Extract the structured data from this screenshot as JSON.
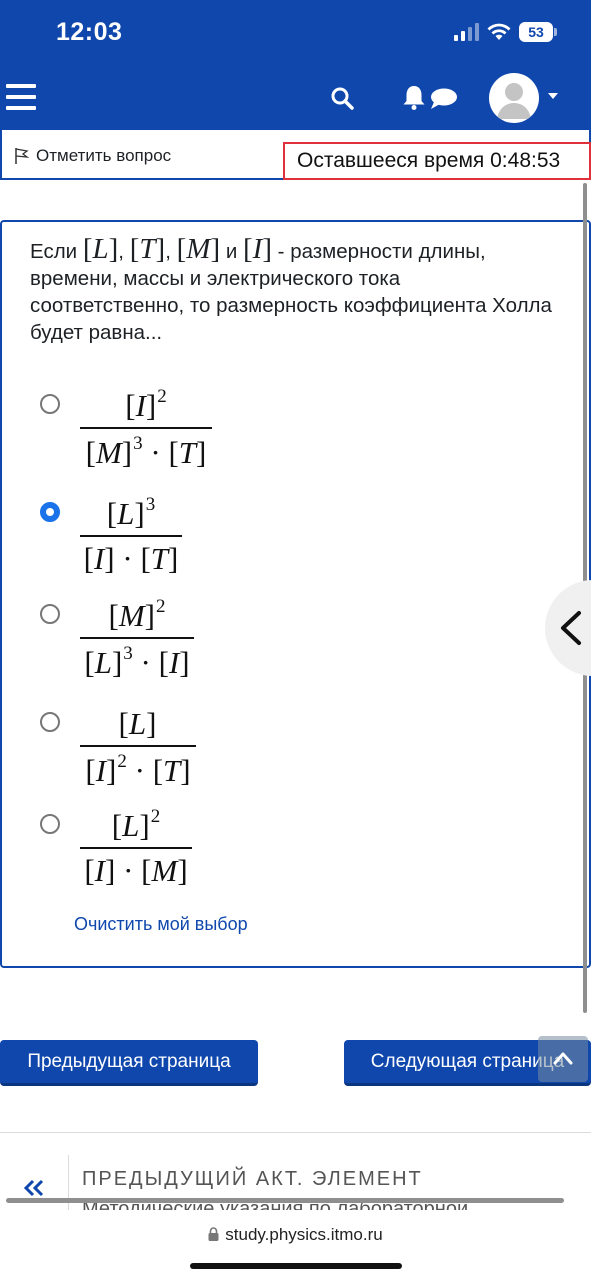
{
  "status_bar": {
    "time": "12:03",
    "battery": "53"
  },
  "header": {
    "flag_label": "Отметить вопрос",
    "timer_text": "Оставшееся время 0:48:53"
  },
  "question": {
    "text_prefix": "Если",
    "dims": [
      "L",
      "T",
      "M",
      "I"
    ],
    "sep_comma": ",",
    "sep_and": "и",
    "text_suffix": " - размерности длины, времени, массы и электрического тока соответственно, то размерность коэффициента Холла будет равна..."
  },
  "options": [
    {
      "selected": false,
      "numerator": [
        {
          "sym": "I",
          "exp": "2"
        }
      ],
      "denominator": [
        {
          "sym": "M",
          "exp": "3"
        },
        {
          "sym": "T",
          "exp": ""
        }
      ]
    },
    {
      "selected": true,
      "numerator": [
        {
          "sym": "L",
          "exp": "3"
        }
      ],
      "denominator": [
        {
          "sym": "I",
          "exp": ""
        },
        {
          "sym": "T",
          "exp": ""
        }
      ]
    },
    {
      "selected": false,
      "numerator": [
        {
          "sym": "M",
          "exp": "2"
        }
      ],
      "denominator": [
        {
          "sym": "L",
          "exp": "3"
        },
        {
          "sym": "I",
          "exp": ""
        }
      ]
    },
    {
      "selected": false,
      "numerator": [
        {
          "sym": "L",
          "exp": ""
        }
      ],
      "denominator": [
        {
          "sym": "I",
          "exp": "2"
        },
        {
          "sym": "T",
          "exp": ""
        }
      ]
    },
    {
      "selected": false,
      "numerator": [
        {
          "sym": "L",
          "exp": "2"
        }
      ],
      "denominator": [
        {
          "sym": "I",
          "exp": ""
        },
        {
          "sym": "M",
          "exp": ""
        }
      ]
    }
  ],
  "clear_choice": "Очистить мой выбор",
  "navigation": {
    "prev_label": "Предыдущая страница",
    "next_label": "Следующая страница"
  },
  "prev_activity": {
    "label": "ПРЕДЫДУЩИЙ АКТ. ЭЛЕМЕНТ",
    "title": "Методические указания по лабораторной"
  },
  "browser": {
    "url": "study.physics.itmo.ru"
  },
  "colors": {
    "brand": "#0f47ad",
    "timer_border": "#e0303c",
    "radio_selected": "#1a73e8"
  }
}
